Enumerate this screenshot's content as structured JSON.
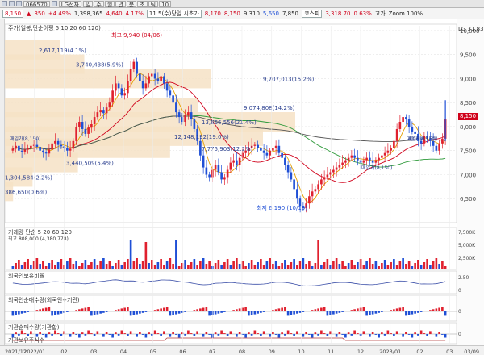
{
  "titlebar": {
    "stock_code": "066570",
    "stock_name": "LG전자"
  },
  "toolbar": {
    "buttons": [
      "일",
      "주",
      "월",
      "년",
      "분",
      "초",
      "틱",
      "10"
    ],
    "price": "8,150",
    "change_arrow": "▲",
    "change": "350",
    "change_pct": "+4.49%",
    "volume": "1,398,365",
    "amount": "4,640",
    "amount_pct": "4.17%",
    "date_and_open": "11.5(수)당일 시초가",
    "open": "8,170",
    "hi": "8,150",
    "hi_pct": "9,310",
    "lo": "5,650",
    "lo2": "7,850",
    "label_kosdaq": "코스피",
    "label_rsi": "3,318.70",
    "label_rate": "0.63%",
    "check_label": "고가",
    "zoom": "Zoom 100%"
  },
  "chart_header": {
    "title_left": "주가(일봉,단순이평 5 10 20 60 120)",
    "max_label": "최고 9,940 (04/06)",
    "min_label": "최저 6,190 (10/19)",
    "right_top": "LG 31.83",
    "price_tag": "8,150"
  },
  "chart_data": {
    "type": "candlestick",
    "ylim": [
      6000,
      10100
    ],
    "y_ticks": [
      6500,
      7000,
      7500,
      8000,
      8500,
      9000,
      9500,
      10000
    ],
    "y_tick_labels": [
      "6,500",
      "7,000",
      "7,500",
      "8,000",
      "8,500",
      "9,000",
      "9,500",
      "10,000"
    ],
    "x_tick_labels": [
      "2021/12",
      "2022/01",
      "02",
      "03",
      "04",
      "05",
      "06",
      "07",
      "08",
      "09",
      "10",
      "11",
      "12",
      "2023/01",
      "02",
      "03",
      "03/09"
    ],
    "candles_close": [
      7540,
      7600,
      7500,
      7480,
      7520,
      7560,
      7600,
      7620,
      7580,
      7500,
      7460,
      7440,
      7520,
      7650,
      7700,
      7620,
      7590,
      7550,
      7500,
      7540,
      7700,
      8000,
      8100,
      7950,
      7850,
      7980,
      8050,
      8200,
      8300,
      8350,
      8280,
      8400,
      8500,
      8750,
      8900,
      8800,
      8650,
      8700,
      8950,
      9200,
      9350,
      9100,
      8950,
      8800,
      8900,
      9050,
      9100,
      9000,
      8950,
      9050,
      8900,
      8750,
      8650,
      8500,
      8300,
      8200,
      8100,
      8250,
      8300,
      8150,
      7950,
      7700,
      7400,
      7150,
      7000,
      6950,
      7100,
      7200,
      7050,
      6900,
      6950,
      7100,
      7250,
      7300,
      7200,
      7350,
      7450,
      7500,
      7550,
      7600,
      7620,
      7550,
      7500,
      7450,
      7400,
      7500,
      7550,
      7600,
      7450,
      7350,
      7200,
      7050,
      6900,
      6700,
      6500,
      6350,
      6300,
      6400,
      6550,
      6650,
      6700,
      6800,
      6900,
      6950,
      7000,
      7050,
      7100,
      7150,
      7200,
      7250,
      7300,
      7350,
      7400,
      7350,
      7300,
      7250,
      7300,
      7350,
      7300,
      7250,
      7300,
      7350,
      7400,
      7450,
      7500,
      7550,
      7700,
      7950,
      8100,
      8200,
      8150,
      8000,
      7900,
      7850,
      7700,
      7650,
      7800,
      7750,
      7700,
      7600,
      7500,
      7650,
      7750,
      8150
    ],
    "volume_profile": [
      {
        "label": "13,666,556(21.4%)",
        "price": 8100,
        "value": 13666556
      },
      {
        "label": "12,148,192(19.0%)",
        "price": 7800,
        "value": 12148192
      },
      {
        "label": "9,707,013(15.2%)",
        "price": 9000,
        "value": 9707013
      },
      {
        "label": "9,074,808(14.2%)",
        "price": 8400,
        "value": 9074808
      },
      {
        "label": "7,775,903(12.2%)",
        "price": 7550,
        "value": 7775903
      },
      {
        "label": "3,740,438(5.9%)",
        "price": 9300,
        "value": 3740438
      },
      {
        "label": "3,440,509(5.4%)",
        "price": 7250,
        "value": 3440509
      },
      {
        "label": "2,617,119(4.1%)",
        "price": 9600,
        "value": 2617119
      },
      {
        "label": "1,304,584(2.2%)",
        "price": 6950,
        "value": 1304584
      },
      {
        "label": "386,650(0.6%)",
        "price": 6650,
        "value": 386650
      }
    ],
    "annotations": [
      "매입가(8,150)",
      "매입가(8,150)",
      "매입가(8,150)",
      "4/06(8,150)"
    ],
    "volume_panel": {
      "title": "거래량 단순 5 20 60 120",
      "sub": "최고 808,000 (4,380,778)",
      "y_labels": [
        "7,500K",
        "5,000K",
        "2,500K"
      ]
    },
    "indicator1": {
      "title": "외국인보유비율",
      "y_labels": [
        "2.50",
        "0"
      ]
    },
    "indicator2": {
      "title": "외국인순매수량(외국인+기관)",
      "y_labels": [
        "0"
      ]
    },
    "indicator3": {
      "title": "기관순매수량(기관합)",
      "y_labels": [
        "0"
      ]
    },
    "indicator4": {
      "title": "기관보유주식수",
      "y_labels": [
        "0"
      ]
    }
  }
}
